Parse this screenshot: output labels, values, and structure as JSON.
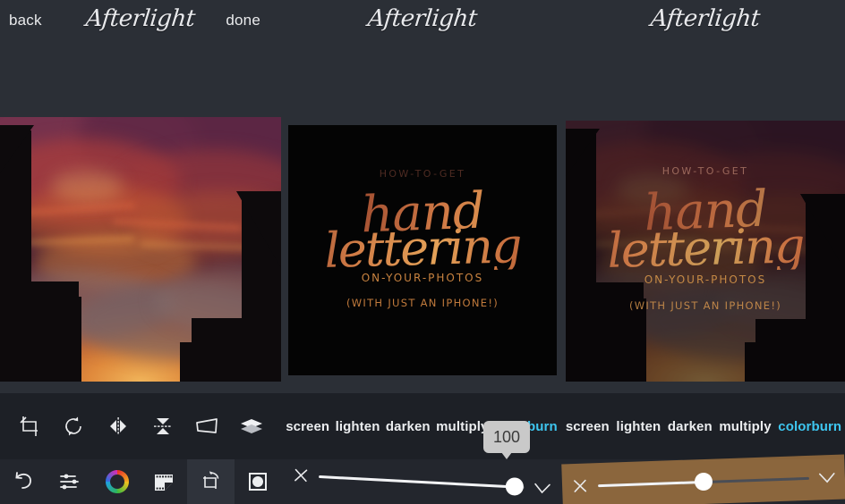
{
  "app": {
    "background": "#2b2f36",
    "bar_background": "#1d2026",
    "accent": "#3ec6f0"
  },
  "panels": [
    {
      "id": "panel-left",
      "header": {
        "back_label": "back",
        "logo": "Afterlight",
        "done_label": "done"
      },
      "image": {
        "kind": "photo",
        "description": "Dramatic purple and orange sunset sky over dark city building silhouettes"
      }
    },
    {
      "id": "panel-center",
      "header": {
        "logo": "Afterlight"
      },
      "image": {
        "kind": "lettering",
        "line1": "HOW-TO-GET",
        "line2": "hand",
        "line3": "lettering",
        "line4": "ON-YOUR-PHOTOS",
        "line5": "(WITH JUST AN IPHONE!)"
      }
    },
    {
      "id": "panel-right",
      "header": {
        "logo": "Afterlight"
      },
      "image": {
        "kind": "blend",
        "line1": "HOW-TO-GET",
        "line2": "hand",
        "line3": "lettering",
        "line4": "ON-YOUR-PHOTOS",
        "line5": "(WITH JUST AN IPHONE!)",
        "description": "Hand lettering blended onto the sunset photo"
      }
    }
  ],
  "transform_tools": [
    {
      "name": "crop-icon",
      "label": "crop"
    },
    {
      "name": "rotate-icon",
      "label": "rotate"
    },
    {
      "name": "flip-horizontal-icon",
      "label": "flip horizontal"
    },
    {
      "name": "flip-vertical-icon",
      "label": "flip vertical"
    },
    {
      "name": "perspective-icon",
      "label": "perspective"
    },
    {
      "name": "layers-icon",
      "label": "layers"
    }
  ],
  "blend_modes_center": {
    "items": [
      {
        "label": "screen",
        "active": false
      },
      {
        "label": "lighten",
        "active": false
      },
      {
        "label": "darken",
        "active": false
      },
      {
        "label": "multiply",
        "active": false
      },
      {
        "label": "colorburn",
        "active": true
      }
    ]
  },
  "blend_modes_right": {
    "items": [
      {
        "label": "screen",
        "active": false
      },
      {
        "label": "lighten",
        "active": false
      },
      {
        "label": "darken",
        "active": false
      },
      {
        "label": "multiply",
        "active": false
      },
      {
        "label": "colorburn",
        "active": true
      }
    ]
  },
  "tooltip": {
    "value": "100"
  },
  "bottom_tabs": [
    {
      "name": "undo-icon",
      "label": "undo",
      "selected": false
    },
    {
      "name": "adjust-sliders-icon",
      "label": "adjust",
      "selected": false
    },
    {
      "name": "color-wheel-icon",
      "label": "color",
      "selected": false
    },
    {
      "name": "film-filter-icon",
      "label": "filters",
      "selected": false
    },
    {
      "name": "transform-icon",
      "label": "transform",
      "selected": true
    },
    {
      "name": "vignette-icon",
      "label": "vignette",
      "selected": false
    }
  ],
  "slider_center": {
    "value": 95,
    "cancel": "cancel",
    "confirm": "confirm"
  },
  "slider_right": {
    "value": 50,
    "cancel": "cancel",
    "confirm": "confirm"
  }
}
